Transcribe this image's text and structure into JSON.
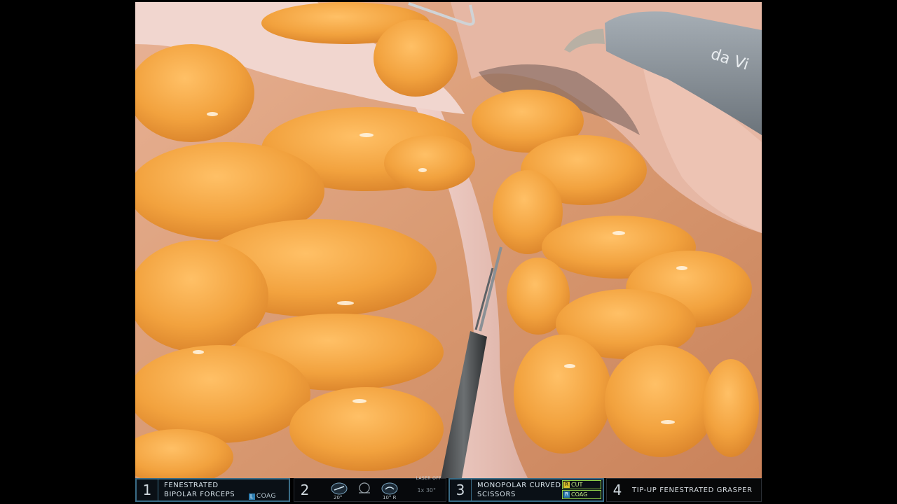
{
  "scene": {
    "description_visible_text": "da Vi"
  },
  "hud": {
    "arm1": {
      "number": "1",
      "line1": "FENESTRATED",
      "line2": "BIPOLAR FORCEPS",
      "energy_chip": "L",
      "energy_label": "COAG"
    },
    "camera": {
      "number": "2",
      "angle_left": "20°",
      "angle_right": "10° R",
      "laser_status": "LASER OFF",
      "zoom": "1x  30°"
    },
    "arm3": {
      "number": "3",
      "line1": "MONOPOLAR CURVED",
      "line2": "SCISSORS",
      "pedal_top_chip": "R",
      "pedal_top_label": "CUT",
      "pedal_bottom_chip": "R",
      "pedal_bottom_label": "COAG"
    },
    "arm4": {
      "number": "4",
      "name": "TIP-UP FENESTRATED GRASPER"
    }
  },
  "colors": {
    "tissue_fat": "#f0a040",
    "tissue_membrane": "#e9c8c0",
    "hud_active_border": "#3a6c86",
    "pedal_active": "#8fd14a",
    "cut_chip": "#d6c12d",
    "coag_chip": "#2e7fb2"
  }
}
